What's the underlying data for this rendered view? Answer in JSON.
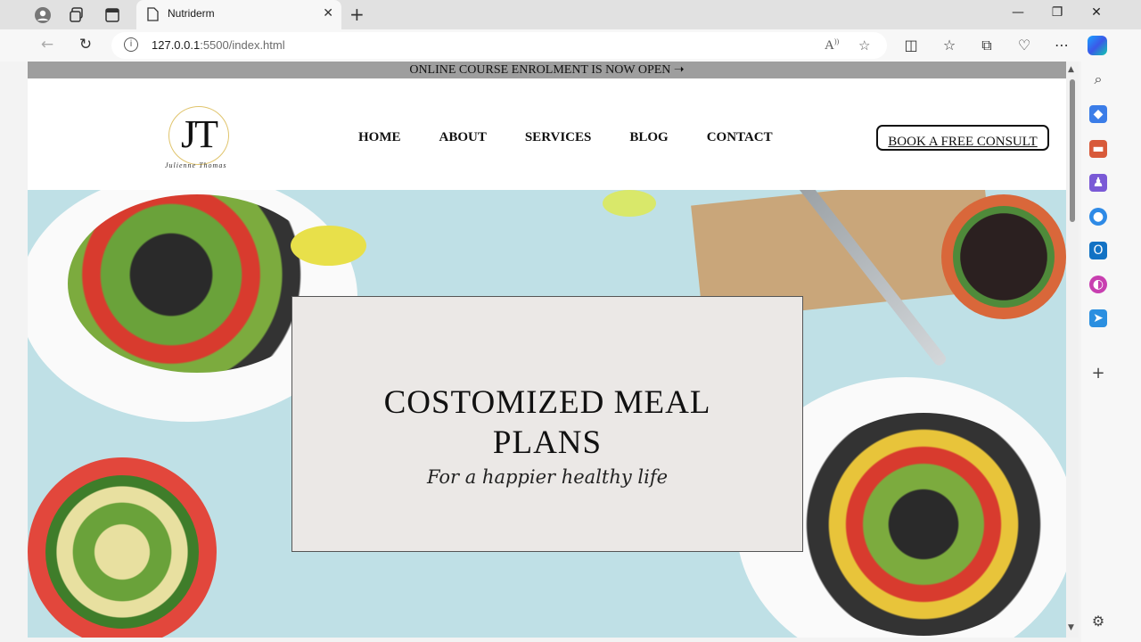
{
  "browser": {
    "tab_title": "Nutriderm",
    "url_host": "127.0.0.1",
    "url_path": ":5500/index.html",
    "new_tab_symbol": "+",
    "close_symbol": "✕"
  },
  "announcement": {
    "text": "ONLINE COURSE ENROLMENT IS NOW OPEN",
    "arrow": "➝"
  },
  "logo": {
    "initials": "JT",
    "tagline": "Julienne Thomas"
  },
  "nav": {
    "items": [
      "HOME",
      "ABOUT",
      "SERVICES",
      "BLOG",
      "CONTACT"
    ]
  },
  "cta": {
    "label": "BOOK A FREE CONSULT"
  },
  "hero": {
    "title_line1": "COSTOMIZED MEAL",
    "title_line2": "PLANS",
    "subtitle": "For a happier healthy life"
  },
  "colors": {
    "announce_bg": "#9e9e9e",
    "hero_bg": "#bfe0e6",
    "card_bg": "#ebe8e6",
    "logo_gold": "#e0c46c"
  }
}
